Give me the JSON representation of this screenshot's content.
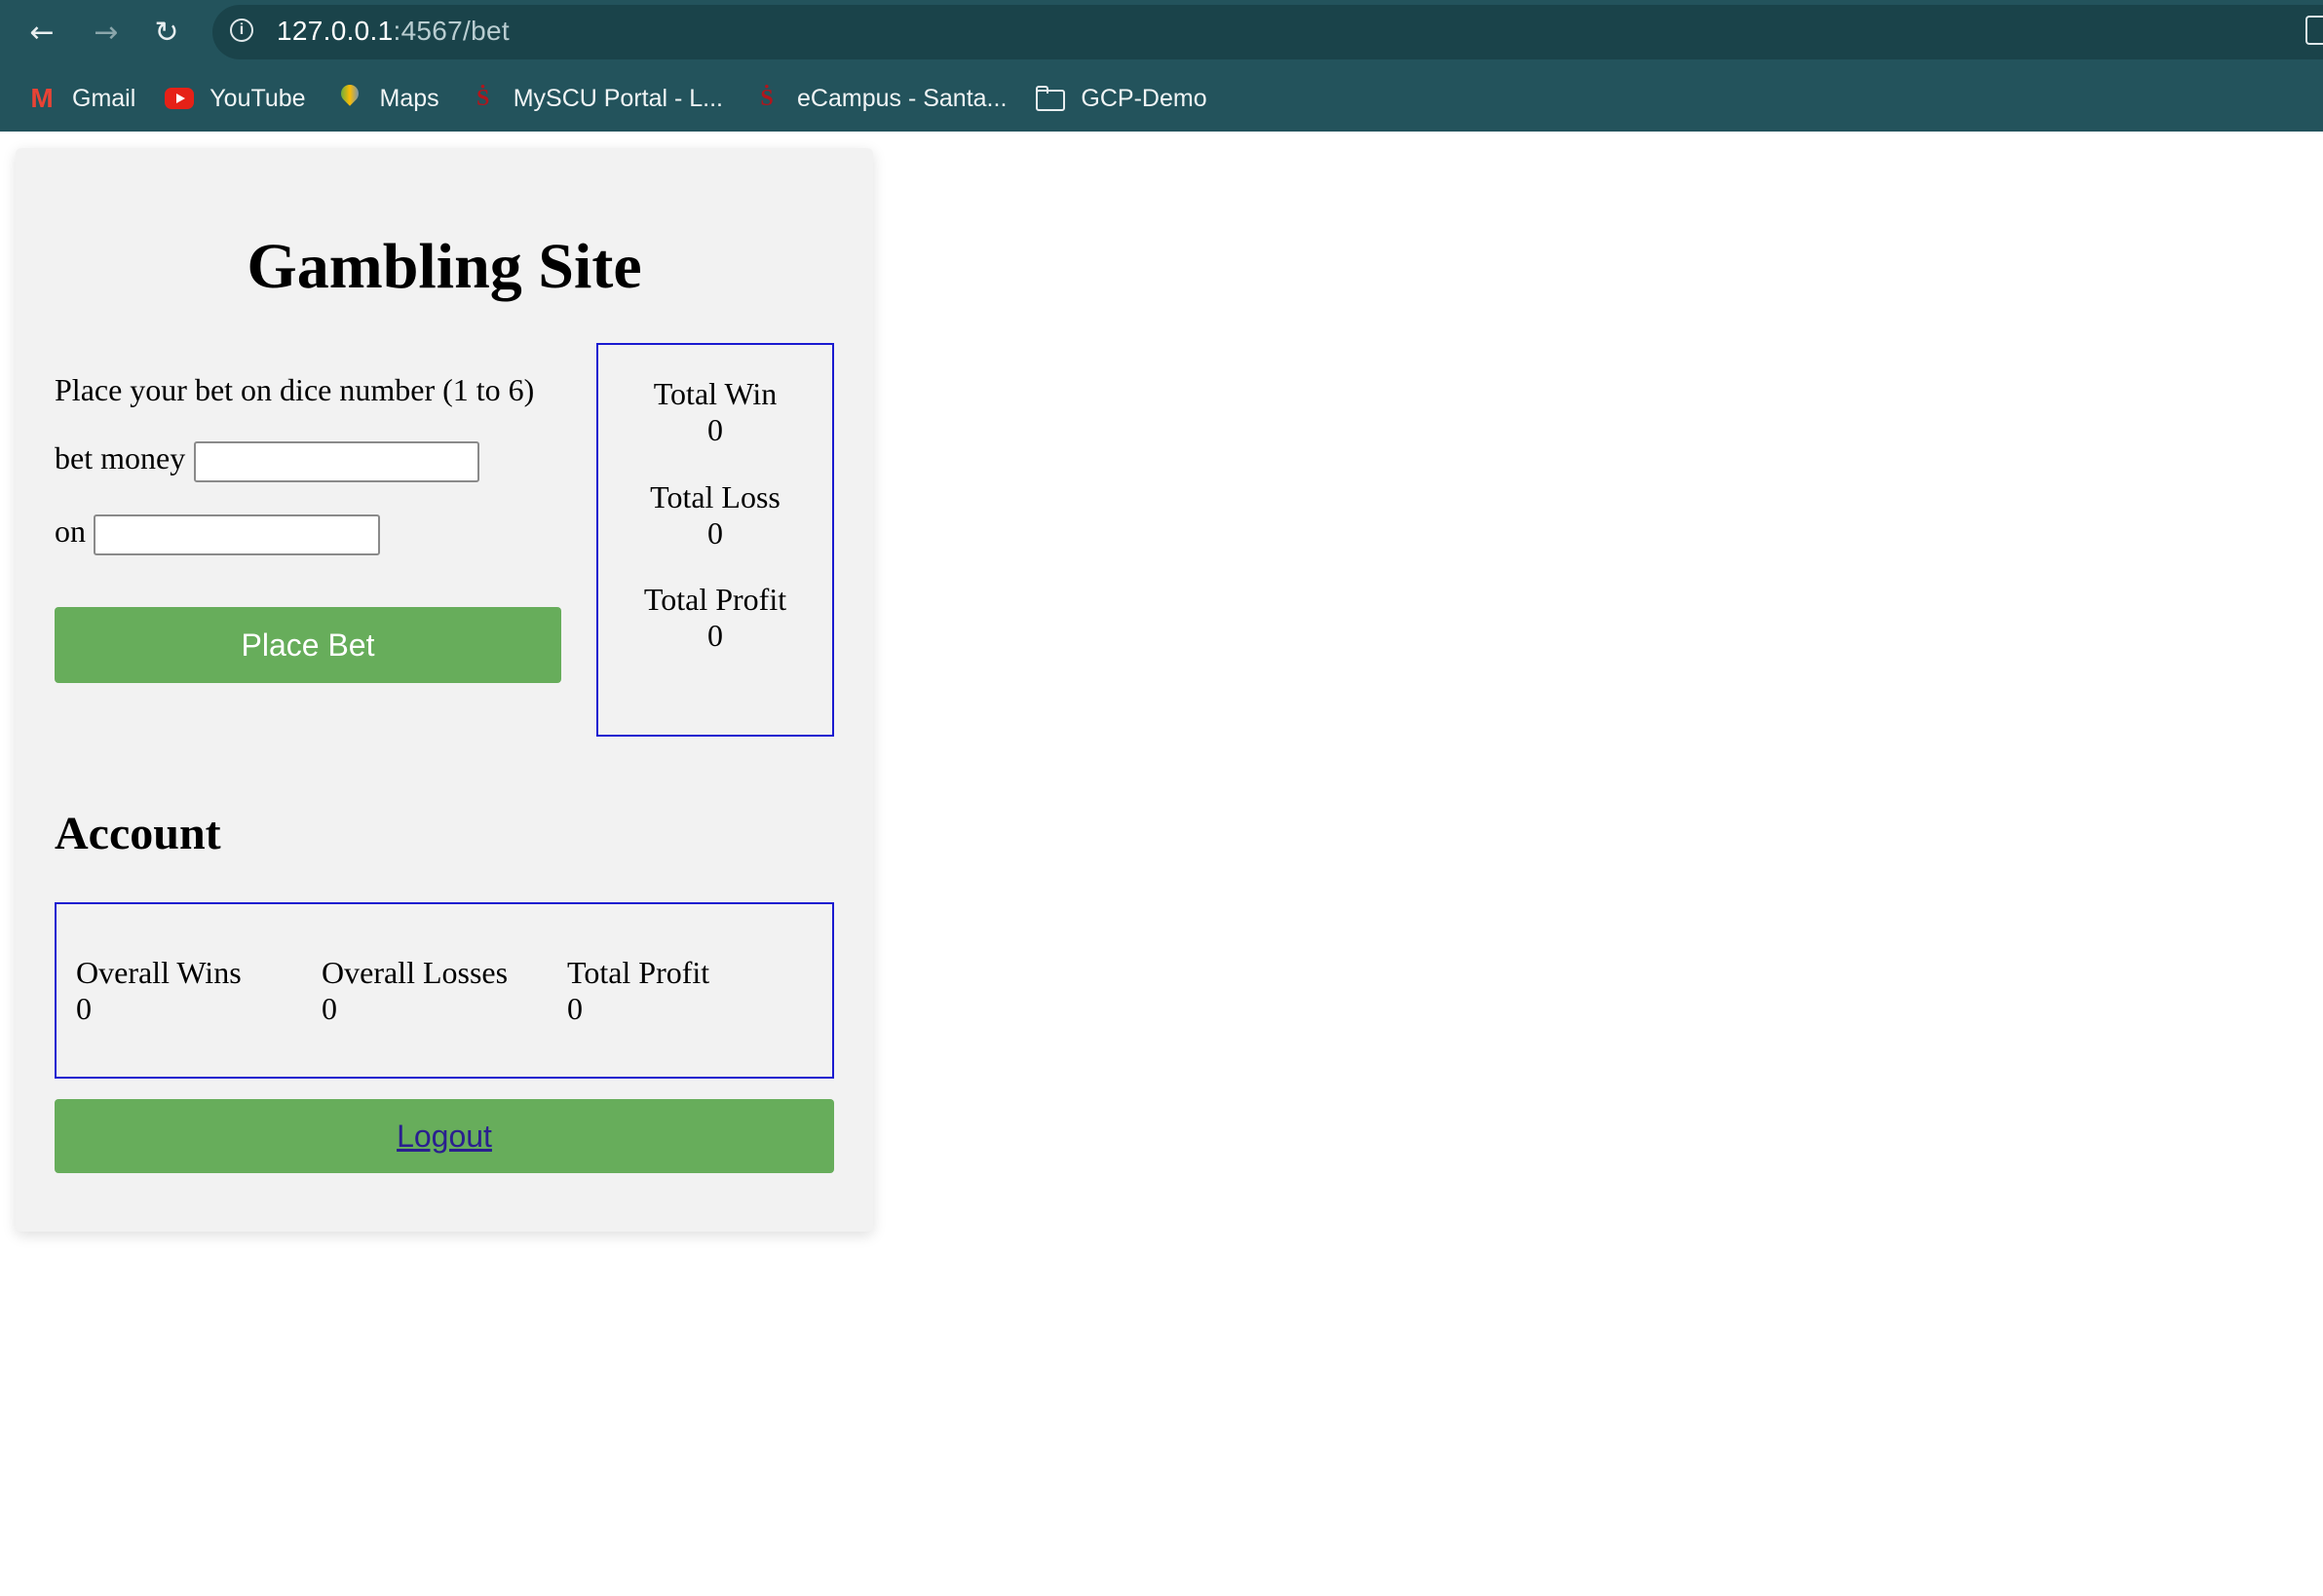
{
  "browser": {
    "url_host": "127.0.0.1",
    "url_rest": ":4567/bet",
    "bookmarks": [
      {
        "label": "Gmail",
        "icon": "gmail-icon"
      },
      {
        "label": "YouTube",
        "icon": "youtube-icon"
      },
      {
        "label": "Maps",
        "icon": "maps-icon"
      },
      {
        "label": "MySCU Portal - L...",
        "icon": "scu-icon"
      },
      {
        "label": "eCampus - Santa...",
        "icon": "scu-icon"
      },
      {
        "label": "GCP-Demo",
        "icon": "folder-icon"
      }
    ]
  },
  "page": {
    "title": "Gambling Site",
    "bet_prompt": "Place your bet on dice number (1 to 6)",
    "bet_money_label": "bet money",
    "bet_money_value": "",
    "on_label": "on",
    "on_value": "",
    "place_bet_label": "Place Bet",
    "stats": {
      "total_win_label": "Total Win",
      "total_win_value": "0",
      "total_loss_label": "Total Loss",
      "total_loss_value": "0",
      "total_profit_label": "Total Profit",
      "total_profit_value": "0"
    },
    "account": {
      "heading": "Account",
      "overall_wins_label": "Overall Wins",
      "overall_wins_value": "0",
      "overall_losses_label": "Overall Losses",
      "overall_losses_value": "0",
      "total_profit_label": "Total Profit",
      "total_profit_value": "0"
    },
    "logout_label": "Logout"
  },
  "colors": {
    "chrome_bg": "#23535c",
    "button_green": "#67ad5b",
    "box_border": "#1a1ad0",
    "link_color": "#2a1f8f"
  }
}
